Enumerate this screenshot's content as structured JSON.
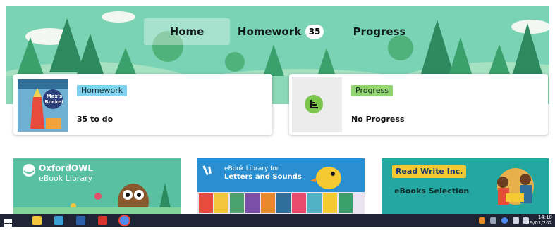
{
  "nav": {
    "tabs": [
      {
        "label": "Home"
      },
      {
        "label": "Homework",
        "badge": "35"
      },
      {
        "label": "Progress"
      }
    ]
  },
  "cards": {
    "homework": {
      "tag": "Homework",
      "status": "35 to do",
      "book_title": "Max's Rocket"
    },
    "progress": {
      "tag": "Progress",
      "status": "No Progress"
    }
  },
  "tiles": {
    "oxford": {
      "line1": "OxfordOWL",
      "line2": "eBook Library"
    },
    "letters": {
      "line1": "eBook Library for",
      "line2": "Letters and Sounds"
    },
    "rwi": {
      "logo": "Read Write Inc.",
      "line2": "eBooks Selection"
    }
  },
  "taskbar": {
    "time": "14:18",
    "date": "19/01/202"
  },
  "colors": {
    "header_bg": "#79d3b4",
    "tree_dark": "#2d8a5f",
    "homework_pill": "#7fd3f0",
    "progress_pill": "#8fd46e",
    "progress_icon": "#7cc54d",
    "oxford_tile": "#59c0a2",
    "letters_tile": "#2a8fd0",
    "rwi_tile": "#25a7a1"
  },
  "icons": {
    "progress": "bar-chart-icon",
    "start": "windows-start-icon"
  }
}
